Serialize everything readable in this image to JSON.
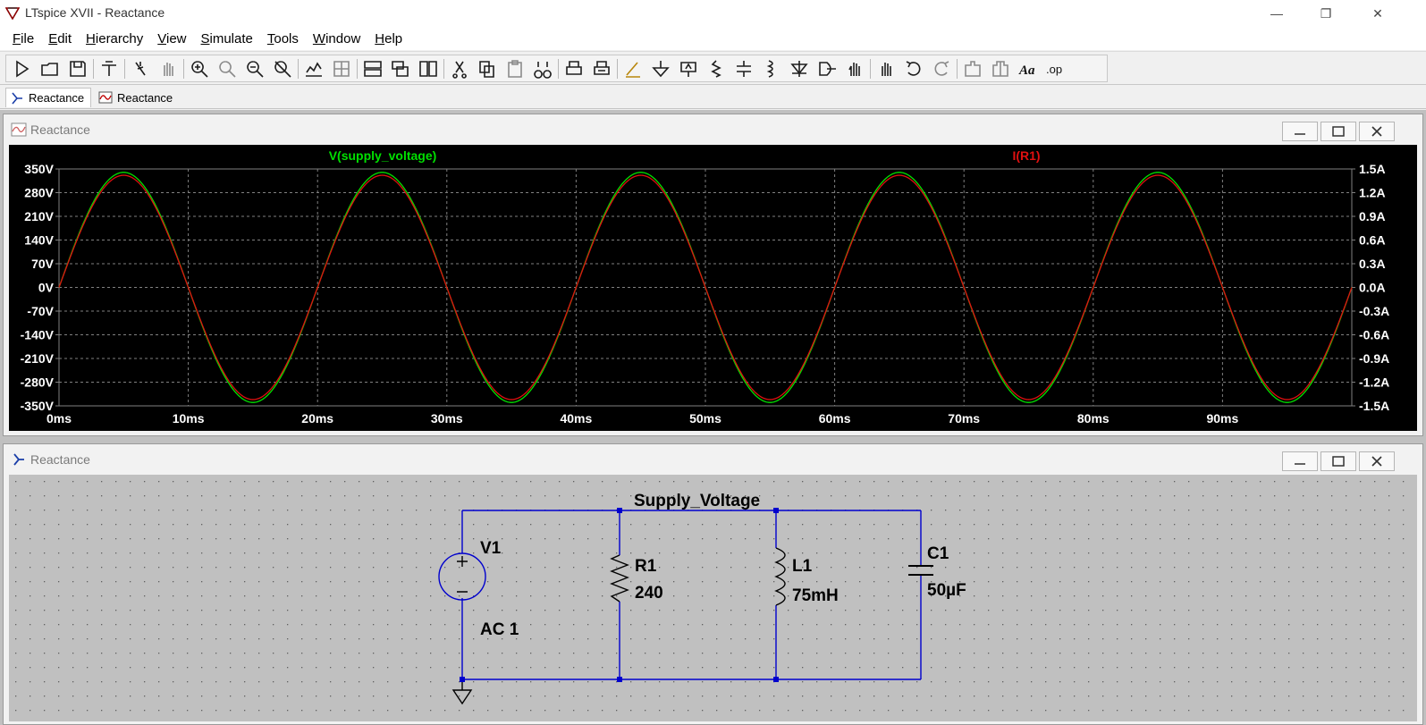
{
  "window": {
    "title": "LTspice XVII - Reactance",
    "controls": {
      "minimize": "—",
      "restore": "❐",
      "close": "✕"
    }
  },
  "menu": [
    {
      "accel": "F",
      "rest": "ile"
    },
    {
      "accel": "E",
      "rest": "dit"
    },
    {
      "accel": "H",
      "rest": "ierarchy"
    },
    {
      "accel": "V",
      "rest": "iew"
    },
    {
      "accel": "S",
      "rest": "imulate"
    },
    {
      "accel": "T",
      "rest": "ools"
    },
    {
      "accel": "W",
      "rest": "indow"
    },
    {
      "accel": "H",
      "rest": "elp"
    }
  ],
  "toolbar": {
    "icons": [
      "run-icon",
      "open-icon",
      "save-icon",
      "control-panel-icon",
      "halt-icon",
      "pan-icon",
      "zoom-in-icon",
      "zoom-area-icon",
      "zoom-out-icon",
      "zoom-fit-icon",
      "autorange-icon",
      "grid-icon",
      "tile-horizontal-icon",
      "cascade-icon",
      "tile-vertical-icon",
      "cut-icon",
      "copy-icon",
      "paste-icon",
      "find-icon",
      "print-icon",
      "print-setup-icon",
      "wire-icon",
      "ground-icon",
      "label-net-icon",
      "resistor-icon",
      "capacitor-icon",
      "inductor-icon",
      "diode-icon",
      "component-icon",
      "move-icon",
      "drag-icon",
      "undo-icon",
      "redo-icon",
      "rotate-icon",
      "mirror-icon",
      "text-icon",
      "spice-directive-icon"
    ],
    "text_tool": "Aa",
    "spice_directive": ".op"
  },
  "tabs": [
    {
      "label": "Reactance",
      "kind": "schematic",
      "active": true
    },
    {
      "label": "Reactance",
      "kind": "waveform",
      "active": false
    }
  ],
  "plot_window": {
    "title": "Reactance",
    "background": "#000000",
    "trace_labels": {
      "voltage": "V(supply_voltage)",
      "current": "I(R1)"
    },
    "colors": {
      "voltage": "#00e000",
      "current": "#e01010",
      "axis_text": "#ffffff",
      "grid": "#808080"
    }
  },
  "chart_data": {
    "type": "line",
    "title": "",
    "x": {
      "unit": "ms",
      "ticks": [
        "0ms",
        "10ms",
        "20ms",
        "30ms",
        "40ms",
        "50ms",
        "60ms",
        "70ms",
        "80ms",
        "90ms"
      ],
      "range": [
        0,
        100
      ]
    },
    "y_left": {
      "unit": "V",
      "ticks": [
        "350V",
        "280V",
        "210V",
        "140V",
        "70V",
        "0V",
        "-70V",
        "-140V",
        "-210V",
        "-280V",
        "-350V"
      ],
      "range": [
        -350,
        350
      ]
    },
    "y_right": {
      "unit": "A",
      "ticks": [
        "1.5A",
        "1.2A",
        "0.9A",
        "0.6A",
        "0.3A",
        "0.0A",
        "-0.3A",
        "-0.6A",
        "-0.9A",
        "-1.2A",
        "-1.5A"
      ],
      "range": [
        -1.5,
        1.5
      ]
    },
    "grid": true,
    "series": [
      {
        "name": "V(supply_voltage)",
        "axis": "left",
        "shape": "sine",
        "amplitude": 340,
        "frequency_hz": 50,
        "phase_deg": 0
      },
      {
        "name": "I(R1)",
        "axis": "right",
        "shape": "sine",
        "amplitude": 1.42,
        "frequency_hz": 50,
        "phase_deg": 0
      }
    ]
  },
  "schematic_window": {
    "title": "Reactance",
    "net_label": "Supply_Voltage",
    "components": [
      {
        "ref": "V1",
        "value": "AC 1"
      },
      {
        "ref": "R1",
        "value": "240"
      },
      {
        "ref": "L1",
        "value": "75mH"
      },
      {
        "ref": "C1",
        "value": "50µF"
      }
    ],
    "colors": {
      "background": "#c0c0c0",
      "wire": "#0000cd",
      "symbol": "#000000",
      "junction": "#0000cd",
      "dots": "#606060"
    }
  }
}
